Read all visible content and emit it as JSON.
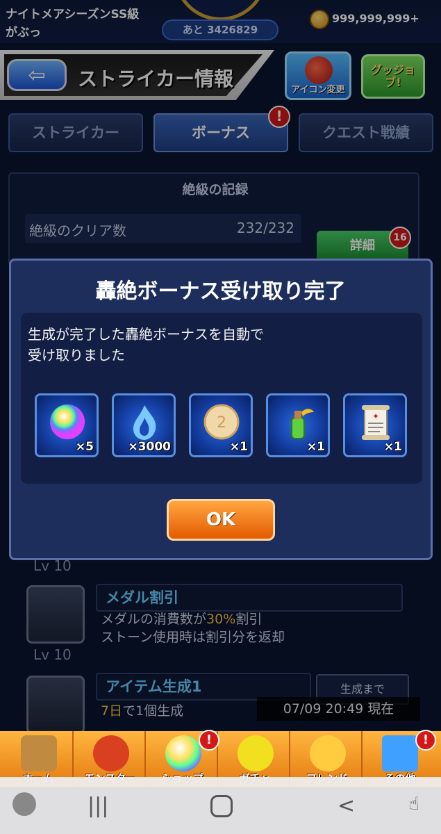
{
  "status": {
    "rank": "ナイトメアシーズンSS級",
    "player_name": "がぶっ",
    "exp_remaining": "あと 3426829",
    "coins": "999,999,999+"
  },
  "header": {
    "title": "ストライカー情報",
    "icon_change_label": "アイコン変更",
    "goodjob_label": "グッジョブ!"
  },
  "tabs": [
    {
      "label": "ストライカー"
    },
    {
      "label": "ボーナス",
      "badge": "!"
    },
    {
      "label": "クエスト戦績"
    }
  ],
  "records": {
    "title": "絶級の記録",
    "clear_label": "絶級のクリア数",
    "clear_value": "232/232",
    "detail_label": "詳細",
    "detail_badge": "16"
  },
  "bonuses": {
    "lv_top": "Lv 10",
    "items": [
      {
        "name": "メダル割引",
        "desc_line1_a": "メダルの消費数が",
        "desc_line1_hl": "30%",
        "desc_line1_b": "割引",
        "desc_line2": "ストーン使用時は割引分を返却",
        "level": "Lv 10"
      },
      {
        "name": "アイテム生成1",
        "desc_hl": "7日",
        "desc_b": "で1個生成",
        "gen_label": "生成まで"
      }
    ],
    "timestamp": "07/09 20:49 現在"
  },
  "modal": {
    "title": "轟絶ボーナス受け取り完了",
    "message_line1": "生成が完了した轟絶ボーナスを自動で",
    "message_line2": "受け取りました",
    "rewards": [
      {
        "icon": "rainbow-orb-icon",
        "qty": "×5"
      },
      {
        "icon": "blue-flame-icon",
        "qty": "×3000"
      },
      {
        "icon": "cookie-icon",
        "qty": "×1"
      },
      {
        "icon": "potion-bottle-icon",
        "qty": "×1"
      },
      {
        "icon": "scroll-icon",
        "qty": "×1"
      }
    ],
    "ok_label": "OK"
  },
  "nav": [
    {
      "label": "ホーム",
      "color": "#c08a40"
    },
    {
      "label": "モンスター",
      "color": "#d84020"
    },
    {
      "label": "ショップ",
      "color": "#ff80c0",
      "badge": "!"
    },
    {
      "label": "ガチャ",
      "color": "#f0e020"
    },
    {
      "label": "フレンド",
      "color": "#ffcc40"
    },
    {
      "label": "その他",
      "color": "#40a0ff",
      "badge": "!"
    }
  ]
}
